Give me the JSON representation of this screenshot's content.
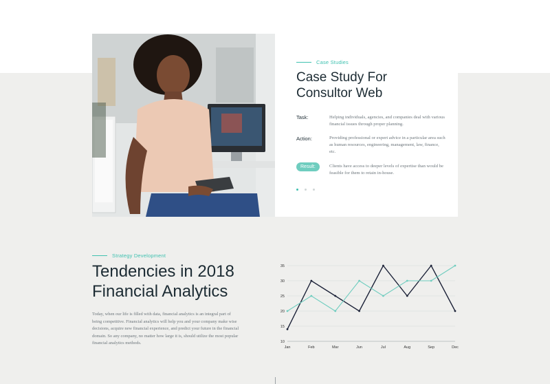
{
  "case": {
    "eyebrow": "Case Studies",
    "title": "Case Study For Consultor Web",
    "task_label": "Task:",
    "task_text": "Helping individuals, agencies, and companies deal with various financial issues through proper planning.",
    "action_label": "Action:",
    "action_text": "Providing professional or expert advice in a particular area such as human resources, engineering, management, law, finance, etc.",
    "result_label": "Result:",
    "result_text": "Clients have access to deeper levels of expertise than would be feasible for them to retain in-house.",
    "slide_count": 3,
    "active_slide": 1
  },
  "strategy": {
    "eyebrow": "Strategy Development",
    "title": "Tendencies in 2018 Financial Analytics",
    "body": "Today, when our life is filled with data, financial analytics is an integral part of being competitive. Financial analytics will help you and your company make wise decisions, acquire new financial experience, and predict your future in the financial domain. So any company, no matter how large it is, should utilize the most popular financial analytics methods."
  },
  "colors": {
    "accent": "#3fc1b0",
    "dark_series": "#1c2238",
    "teal_series": "#6fcdbf"
  },
  "chart_data": {
    "type": "line",
    "x": [
      "Jan",
      "Feb",
      "Mar",
      "Jun",
      "Jul",
      "Aug",
      "Sep",
      "Dec"
    ],
    "yticks": [
      10,
      15,
      20,
      25,
      30,
      35
    ],
    "ylim": [
      10,
      35
    ],
    "grid": true,
    "series": [
      {
        "color": "#1c2238",
        "values": [
          14,
          30,
          25,
          20,
          35,
          25,
          35,
          20
        ]
      },
      {
        "color": "#6fcdbf",
        "values": [
          20,
          25,
          20,
          30,
          25,
          30,
          30,
          35
        ]
      }
    ]
  }
}
